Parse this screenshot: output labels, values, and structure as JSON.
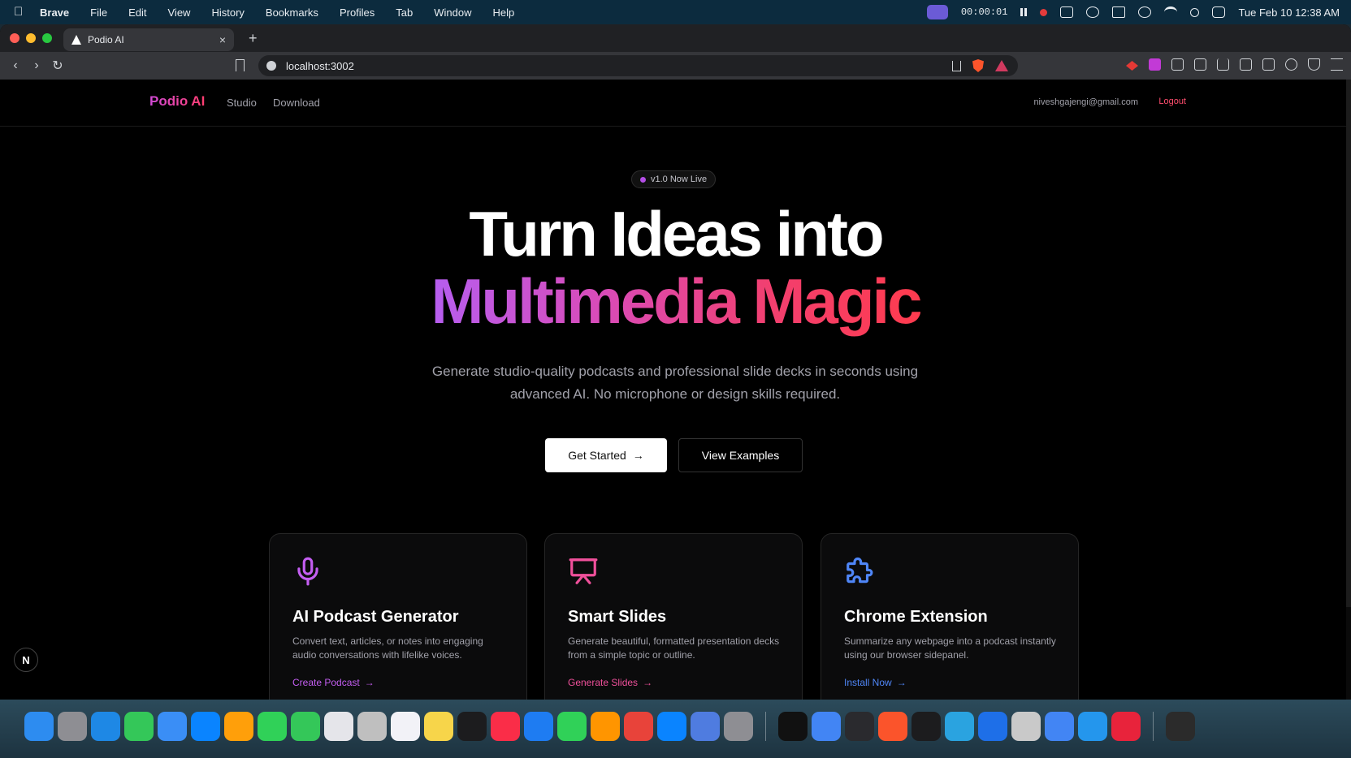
{
  "menubar": {
    "app_name": "Brave",
    "items": [
      "File",
      "Edit",
      "View",
      "History",
      "Bookmarks",
      "Profiles",
      "Tab",
      "Window",
      "Help"
    ],
    "recording_time": "00:00:01",
    "clock": "Tue Feb 10  12:38 AM"
  },
  "browser": {
    "tab_title": "Podio AI",
    "url": "localhost:3002",
    "new_tab": "+",
    "tab_close": "×"
  },
  "site": {
    "logo": "Podio AI",
    "nav": [
      "Studio",
      "Download"
    ],
    "user_email": "niveshgajengi@gmail.com",
    "logout": "Logout"
  },
  "hero": {
    "badge": "v1.0 Now Live",
    "line1": "Turn Ideas into",
    "line2": "Multimedia Magic",
    "subtitle": "Generate studio-quality podcasts and professional slide decks in seconds using advanced AI. No microphone or design skills required.",
    "primary_button": "Get Started",
    "secondary_button": "View Examples"
  },
  "cards": [
    {
      "title": "AI Podcast Generator",
      "desc": "Convert text, articles, or notes into engaging audio conversations with lifelike voices.",
      "link": "Create Podcast",
      "icon": "microphone-icon",
      "color": "#c45ef2"
    },
    {
      "title": "Smart Slides",
      "desc": "Generate beautiful, formatted presentation decks from a simple topic or outline.",
      "link": "Generate Slides",
      "icon": "presentation-icon",
      "color": "#f0509b"
    },
    {
      "title": "Chrome Extension",
      "desc": "Summarize any webpage into a podcast instantly using our browser sidepanel.",
      "link": "Install Now",
      "icon": "puzzle-icon",
      "color": "#4f86f7"
    }
  ],
  "n_button": "N",
  "dock": {
    "colors": [
      "#2d8cf0",
      "#8e8e93",
      "#1e88e5",
      "#34c759",
      "#3a8ef6",
      "#0a84ff",
      "#ff9f0a",
      "#30d158",
      "#34c759",
      "#e5e5ea",
      "#bfbfbf",
      "#f2f2f7",
      "#f7d54a",
      "#1c1c1e",
      "#fa2d48",
      "#1e7cf2",
      "#30d158",
      "#ff9500",
      "#e8433a",
      "#0a84ff",
      "#4f7ce0",
      "#8e8e93",
      "#111111",
      "#4285f4",
      "#2a2a2e",
      "#fb542b",
      "#1c1c1e",
      "#2aa3e0",
      "#1e6fe8",
      "#c9c9c9",
      "#4285f4",
      "#2496ed",
      "#e8233b",
      "#2b2b2b"
    ]
  }
}
